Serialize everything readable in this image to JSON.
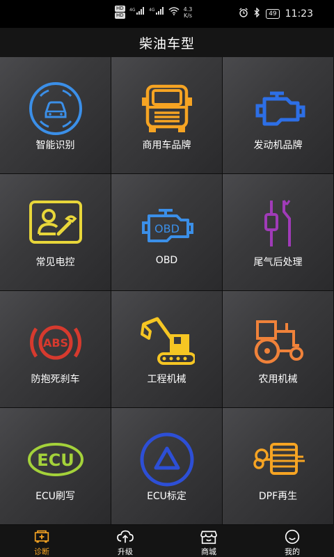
{
  "status_bar": {
    "hd1": "HD",
    "hd2": "HD",
    "net1": "4G",
    "net2": "4G",
    "speed_value": "4.3",
    "speed_unit": "K/s",
    "battery": "49",
    "time": "11:23"
  },
  "header": {
    "title": "柴油车型"
  },
  "grid": {
    "items": [
      {
        "label": "智能识别",
        "icon": "smart-identify-icon",
        "color": "#3b8fe8"
      },
      {
        "label": "商用车品牌",
        "icon": "truck-icon",
        "color": "#f6a423"
      },
      {
        "label": "发动机品牌",
        "icon": "engine-icon",
        "color": "#2d6fe6"
      },
      {
        "label": "常见电控",
        "icon": "user-wrench-icon",
        "color": "#e8d63a"
      },
      {
        "label": "OBD",
        "icon": "obd-engine-icon",
        "color": "#3b8fe8"
      },
      {
        "label": "尾气后处理",
        "icon": "exhaust-aftertreatment-icon",
        "color": "#a03bb8"
      },
      {
        "label": "防抱死刹车",
        "icon": "abs-icon",
        "color": "#d63a2e"
      },
      {
        "label": "工程机械",
        "icon": "excavator-icon",
        "color": "#f6c623"
      },
      {
        "label": "农用机械",
        "icon": "tractor-icon",
        "color": "#f0823a"
      },
      {
        "label": "ECU刷写",
        "icon": "ecu-icon",
        "color": "#a4d23a"
      },
      {
        "label": "ECU标定",
        "icon": "ecu-calibrate-icon",
        "color": "#2d4fd6"
      },
      {
        "label": "DPF再生",
        "icon": "dpf-icon",
        "color": "#f6a423"
      }
    ],
    "obd_text": "OBD",
    "abs_text": "ABS",
    "ecu_text": "ECU"
  },
  "tabbar": {
    "tabs": [
      {
        "label": "诊断",
        "icon": "diagnose-icon",
        "active": true
      },
      {
        "label": "升级",
        "icon": "cloud-upload-icon",
        "active": false
      },
      {
        "label": "商城",
        "icon": "store-icon",
        "active": false
      },
      {
        "label": "我的",
        "icon": "smile-face-icon",
        "active": false
      }
    ],
    "active_color": "#f6a423"
  }
}
